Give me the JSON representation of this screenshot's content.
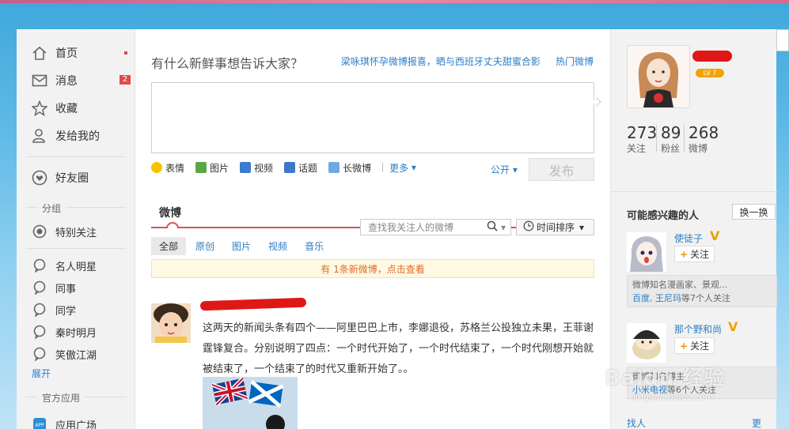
{
  "nav": {
    "home": "首页",
    "messages": "消息",
    "messages_badge": "2",
    "favorites": "收藏",
    "sent_to_me": "发给我的",
    "friends_circle": "好友圈",
    "group_header": "分组",
    "special_follow": "特别关注",
    "groups": [
      "名人明星",
      "同事",
      "同学",
      "秦时明月",
      "笑傲江湖"
    ],
    "expand": "展开",
    "official_apps_header": "官方应用",
    "app_square": "应用广场"
  },
  "composer": {
    "prompt": "有什么新鲜事想告诉大家？",
    "hot_topic_1": "梁咏琪怀孕微博报喜，晒与西班牙丈夫甜蜜合影",
    "hot_more": "热门微博",
    "tools": [
      "表情",
      "图片",
      "视频",
      "话题",
      "长微博"
    ],
    "more": "更多",
    "visibility": "公开",
    "publish": "发布"
  },
  "feed": {
    "title": "微博",
    "search_placeholder": "查找我关注人的微博",
    "sort": "时间排序",
    "filters": [
      "全部",
      "原创",
      "图片",
      "视频",
      "音乐"
    ],
    "new_notice": "有 1条新微博，点击查看",
    "post_text": "这两天的新闻头条有四个——阿里巴巴上市，李娜退役，苏格兰公投独立未果，王菲谢霆锋复合。分别说明了四点：一个时代开始了，一个时代结束了，一个时代刚想开始就被结束了，一个结束了的时代又重新开始了。。"
  },
  "profile": {
    "level": "LV 7",
    "stats": [
      {
        "num": "273",
        "label": "关注"
      },
      {
        "num": "89",
        "label": "粉丝"
      },
      {
        "num": "268",
        "label": "微博"
      }
    ]
  },
  "suggest": {
    "title": "可能感兴趣的人",
    "swap": "换一换",
    "follow": "关注",
    "users": [
      {
        "name": "使徒子",
        "desc": "微博知名漫画家、景观...",
        "links": "百度, 王尼玛",
        "tail": "等7个人关注"
      },
      {
        "name": "那个野和尚",
        "desc": "微博知名博主...",
        "links": "小米电视",
        "tail": "等6个人关注"
      }
    ],
    "find_people": "找人",
    "more": "更多»"
  },
  "watermark": {
    "main": "Baidu 经验",
    "sub": "jingyan.baidu.com"
  }
}
